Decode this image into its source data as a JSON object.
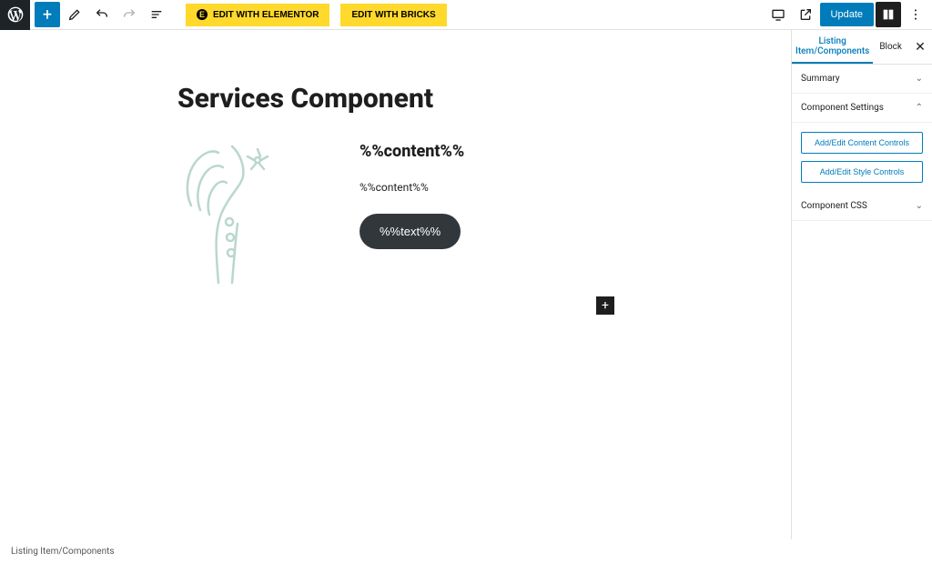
{
  "toolbar": {
    "elementor_label": "EDIT WITH ELEMENTOR",
    "bricks_label": "EDIT WITH BRICKS",
    "update_label": "Update"
  },
  "page": {
    "title": "Services Component",
    "content_heading": "%%content%%",
    "content_text": "%%content%%",
    "button_text": "%%text%%"
  },
  "sidebar": {
    "tabs": {
      "listing": "Listing Item/Components",
      "block": "Block"
    },
    "sections": {
      "summary": "Summary",
      "component_settings": "Component Settings",
      "component_css": "Component CSS"
    },
    "buttons": {
      "content_controls": "Add/Edit Content Controls",
      "style_controls": "Add/Edit Style Controls"
    }
  },
  "breadcrumb": "Listing Item/Components"
}
